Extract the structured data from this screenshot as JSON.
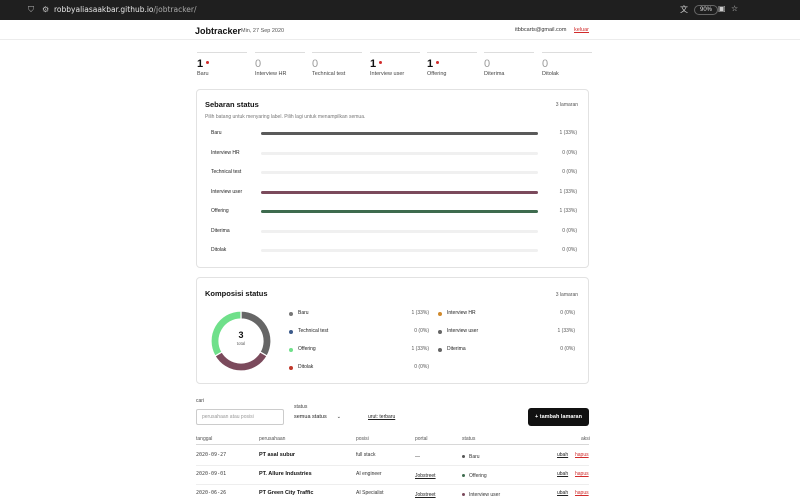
{
  "browser": {
    "url_host": "robbyaliasaakbar.github.io",
    "url_path": "/jobtracker/",
    "zoom": "90%"
  },
  "header": {
    "brand": "Jobtracker",
    "date": "Min, 27 Sep 2020",
    "email": "itbbcarts@gmail.com",
    "logout": "keluar"
  },
  "stats": [
    {
      "count": "1",
      "label": "Baru",
      "alert": true
    },
    {
      "count": "0",
      "label": "Interview HR",
      "alert": false
    },
    {
      "count": "0",
      "label": "Technical test",
      "alert": false
    },
    {
      "count": "1",
      "label": "Interview user",
      "alert": true
    },
    {
      "count": "1",
      "label": "Offering",
      "alert": true
    },
    {
      "count": "0",
      "label": "Diterima",
      "alert": false
    },
    {
      "count": "0",
      "label": "Ditolak",
      "alert": false
    }
  ],
  "distribution": {
    "title": "Sebaran status",
    "count_label": "3 lamaran",
    "subtitle": "Pilih batang untuk menyaring label. Pilih lagi untuk menampilkan semua.",
    "rows": [
      {
        "label": "Baru",
        "value_label": "1 (33%)",
        "fraction": 1,
        "color": "#5a5a5a"
      },
      {
        "label": "Interview HR",
        "value_label": "0 (0%)",
        "fraction": 0,
        "color": "#d08a2e"
      },
      {
        "label": "Technical test",
        "value_label": "0 (0%)",
        "fraction": 0,
        "color": "#3c5a8a"
      },
      {
        "label": "Interview user",
        "value_label": "1 (33%)",
        "fraction": 1,
        "color": "#7b4a5c"
      },
      {
        "label": "Offering",
        "value_label": "1 (33%)",
        "fraction": 1,
        "color": "#3e6b4e"
      },
      {
        "label": "Diterima",
        "value_label": "0 (0%)",
        "fraction": 0,
        "color": "#777777"
      },
      {
        "label": "Ditolak",
        "value_label": "0 (0%)",
        "fraction": 0,
        "color": "#c0392b"
      }
    ]
  },
  "composition": {
    "title": "Komposisi status",
    "count_label": "3 lamaran",
    "total_value": "3",
    "total_label": "total",
    "donut": [
      {
        "label": "Baru",
        "fraction": 0.3333,
        "color": "#666666"
      },
      {
        "label": "Interview user",
        "fraction": 0.3333,
        "color": "#7b4a5c"
      },
      {
        "label": "Offering",
        "fraction": 0.3334,
        "color": "#6fe08a"
      }
    ],
    "legend": [
      {
        "label": "Baru",
        "value": "1 (33%)",
        "color": "#777777"
      },
      {
        "label": "Interview HR",
        "value": "0 (0%)",
        "color": "#d08a2e"
      },
      {
        "label": "Technical test",
        "value": "0 (0%)",
        "color": "#3c5a8a"
      },
      {
        "label": "Interview user",
        "value": "1 (33%)",
        "color": "#666666"
      },
      {
        "label": "Offering",
        "value": "1 (33%)",
        "color": "#6fe08a"
      },
      {
        "label": "Diterima",
        "value": "0 (0%)",
        "color": "#666666"
      },
      {
        "label": "Ditolak",
        "value": "0 (0%)",
        "color": "#c0392b"
      }
    ]
  },
  "filters": {
    "search_label": "cari",
    "search_placeholder": "perusahaan atau posisi",
    "status_label": "status",
    "status_value": "semua status",
    "sort_label": "urut: terbaru",
    "add_button": "+ tambah lamaran"
  },
  "table": {
    "headers": [
      "tanggal",
      "perusahaan",
      "posisi",
      "portal",
      "status",
      "aksi"
    ],
    "rows": [
      {
        "date": "2020-09-27",
        "company": "PT asal subur",
        "position": "full stack",
        "portal": "—",
        "portal_link": false,
        "status": "Baru",
        "status_color": "#555555",
        "edit": "ubah",
        "delete": "hapus"
      },
      {
        "date": "2020-09-01",
        "company": "PT. Allure Industries",
        "position": "AI engineer",
        "portal": "Jobstreet",
        "portal_link": true,
        "status": "Offering",
        "status_color": "#3e6b4e",
        "edit": "ubah",
        "delete": "hapus"
      },
      {
        "date": "2020-06-26",
        "company": "PT Green City Traffic",
        "position": "AI Specialist",
        "portal": "Jobstreet",
        "portal_link": true,
        "status": "Interview user",
        "status_color": "#7b4a5c",
        "edit": "ubah",
        "delete": "hapus"
      }
    ]
  }
}
